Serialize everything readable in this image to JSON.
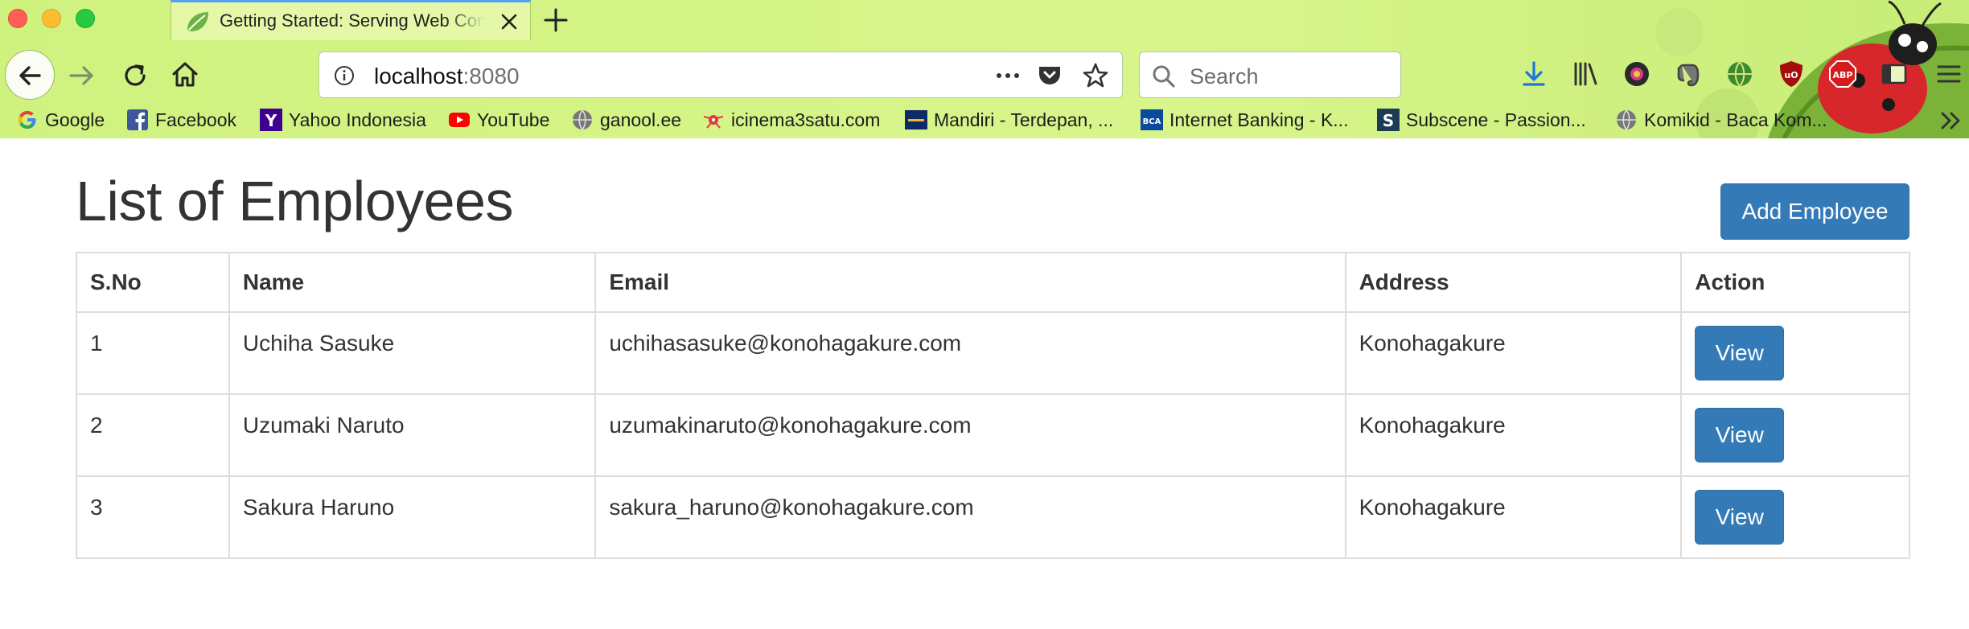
{
  "browser": {
    "tab_title": "Getting Started: Serving Web Content",
    "url_host": "localhost",
    "url_port": ":8080",
    "search_placeholder": "Search",
    "bookmarks": [
      {
        "label": "Google",
        "icon": "google-icon"
      },
      {
        "label": "Facebook",
        "icon": "facebook-icon"
      },
      {
        "label": "Yahoo Indonesia",
        "icon": "yahoo-icon"
      },
      {
        "label": "YouTube",
        "icon": "youtube-icon"
      },
      {
        "label": "ganool.ee",
        "icon": "globe-icon"
      },
      {
        "label": "icinema3satu.com",
        "icon": "film-reel-icon"
      },
      {
        "label": "Mandiri - Terdepan, ...",
        "icon": "mandiri-icon"
      },
      {
        "label": "Internet Banking - K...",
        "icon": "bca-icon"
      },
      {
        "label": "Subscene - Passion...",
        "icon": "subscene-icon"
      },
      {
        "label": "Komikid - Baca Kom...",
        "icon": "globe-icon"
      }
    ],
    "theme_colors": {
      "toolbar": "#cff27f",
      "tab_accent": "#54a0f1"
    }
  },
  "page": {
    "title": "List of Employees",
    "add_button_label": "Add Employee",
    "table": {
      "headers": [
        "S.No",
        "Name",
        "Email",
        "Address",
        "Action"
      ],
      "rows": [
        {
          "sno": "1",
          "name": "Uchiha Sasuke",
          "email": "uchihasasuke@konohagakure.com",
          "address": "Konohagakure",
          "action": "View"
        },
        {
          "sno": "2",
          "name": "Uzumaki Naruto",
          "email": "uzumakinaruto@konohagakure.com",
          "address": "Konohagakure",
          "action": "View"
        },
        {
          "sno": "3",
          "name": "Sakura Haruno",
          "email": "sakura_haruno@konohagakure.com",
          "address": "Konohagakure",
          "action": "View"
        }
      ]
    },
    "colors": {
      "primary_button": "#337ab7",
      "table_border": "#dddddd",
      "text": "#333333"
    }
  }
}
